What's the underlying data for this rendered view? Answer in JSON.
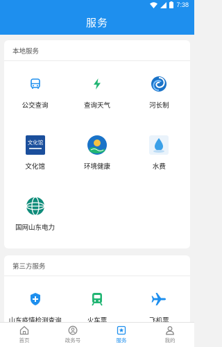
{
  "status_bar": {
    "time": "7:38"
  },
  "header": {
    "title": "服务"
  },
  "local": {
    "title": "本地服务",
    "items": [
      {
        "label": "公交查询",
        "icon": "bus-icon"
      },
      {
        "label": "查询天气",
        "icon": "lightning-icon"
      },
      {
        "label": "河长制",
        "icon": "swirl-icon"
      },
      {
        "label": "文化馆",
        "icon": "culture-center-logo-icon",
        "logo_text": "文化馆"
      },
      {
        "label": "环境健康",
        "icon": "environment-emblem-icon"
      },
      {
        "label": "水费",
        "icon": "water-drop-icon"
      },
      {
        "label": "国网山东电力",
        "icon": "state-grid-icon"
      }
    ]
  },
  "third": {
    "title": "第三方服务",
    "items": [
      {
        "label": "山东疫情检测查询",
        "icon": "shield-icon"
      },
      {
        "label": "火车票",
        "icon": "train-icon"
      },
      {
        "label": "飞机票",
        "icon": "airplane-icon"
      }
    ]
  },
  "tabs": [
    {
      "label": "首页",
      "icon": "home-icon",
      "active": false
    },
    {
      "label": "政务号",
      "icon": "badge-icon",
      "active": false
    },
    {
      "label": "服务",
      "icon": "service-icon",
      "active": true
    },
    {
      "label": "我的",
      "icon": "profile-icon",
      "active": false
    }
  ],
  "colors": {
    "brand": "#1e8fee",
    "green": "#21b573",
    "background": "#f2f2f2"
  }
}
